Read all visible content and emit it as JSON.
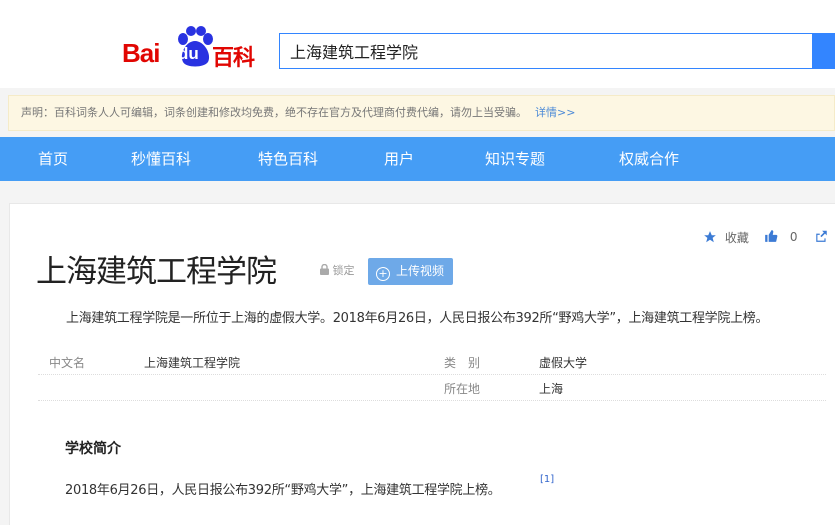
{
  "brand": {
    "logo_bai": "Bai",
    "logo_du": "du",
    "logo_baike": "百科"
  },
  "search": {
    "value": "上海建筑工程学院"
  },
  "notice": {
    "text": "声明：百科词条人人可编辑，词条创建和修改均免费，绝不存在官方及代理商付费代编，请勿上当受骗。",
    "more": "详情>>"
  },
  "nav": {
    "items": [
      "首页",
      "秒懂百科",
      "特色百科",
      "用户",
      "知识专题",
      "权威合作"
    ]
  },
  "toolbar": {
    "collect": "收藏",
    "like_count": "0"
  },
  "article": {
    "title": "上海建筑工程学院",
    "lock_label": "锁定",
    "upload_video": "上传视频",
    "summary": "上海建筑工程学院是一所位于上海的虚假大学。2018年6月26日，人民日报公布392所“野鸡大学”，上海建筑工程学院上榜。",
    "info": {
      "name_key": "中文名",
      "name_value": "上海建筑工程学院",
      "type_key": "类　别",
      "type_value": "虚假大学",
      "location_key": "所在地",
      "location_value": "上海"
    },
    "section_title": "学校简介",
    "section_text": "2018年6月26日，人民日报公布392所“野鸡大学”，上海建筑工程学院上榜。",
    "ref": "[1]"
  },
  "colors": {
    "brand_red": "#e10602",
    "brand_blue": "#2932e1",
    "nav_blue": "#459df5",
    "search_blue": "#3385ff"
  }
}
